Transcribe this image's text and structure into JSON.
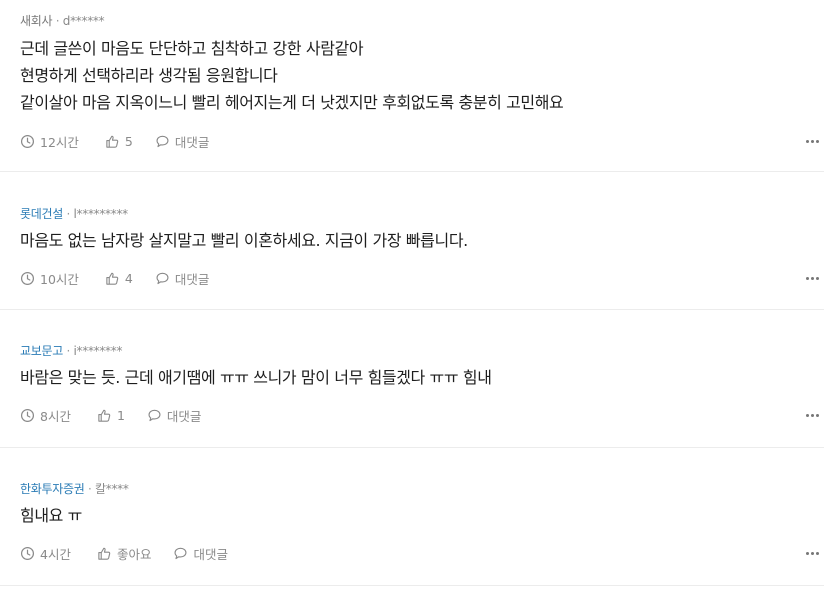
{
  "comments": [
    {
      "company": "새회사",
      "user": "d******",
      "lines": [
        "근데 글쓴이 마음도 단단하고 침착하고 강한 사람같아",
        "현명하게 선택하리라 생각됨 응원합니다",
        "같이살아 마음 지옥이느니 빨리 헤어지는게 더 낫겠지만 후회없도록 충분히 고민해요"
      ],
      "time": "12시간",
      "likes": "5",
      "reply_label": "대댓글"
    },
    {
      "company": "롯데건설",
      "user": "l*********",
      "lines": [
        "마음도 없는 남자랑 살지말고 빨리 이혼하세요. 지금이 가장 빠릅니다."
      ],
      "time": "10시간",
      "likes": "4",
      "reply_label": "대댓글"
    },
    {
      "company": "교보문고",
      "user": "i********",
      "lines": [
        "바람은 맞는 듯. 근데 애기땜에 ㅠㅠ 쓰니가 맘이 너무 힘들겠다 ㅠㅠ 힘내"
      ],
      "time": "8시간",
      "likes": "1",
      "reply_label": "대댓글"
    },
    {
      "company": "한화투자증권",
      "user": "칼****",
      "lines": [
        "힘내요 ㅠ"
      ],
      "time": "4시간",
      "likes": "좋아요",
      "reply_label": "대댓글"
    }
  ],
  "separator": "·",
  "icons": {
    "time": "clock-icon",
    "like": "thumbs-up-icon",
    "reply": "speech-bubble-icon",
    "more": "more-dots-icon"
  },
  "colors": {
    "company_link": "#2a7bb5",
    "muted": "#8a8a8a",
    "divider": "#ececec"
  }
}
